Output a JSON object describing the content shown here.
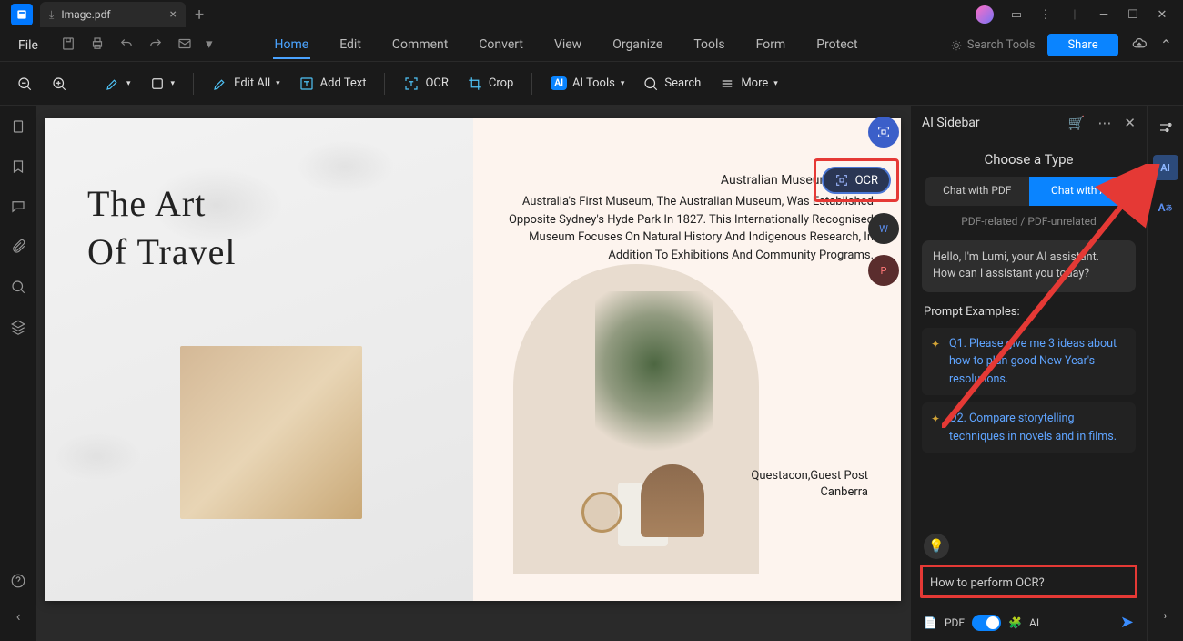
{
  "titlebar": {
    "tab_name": "Image.pdf"
  },
  "menubar": {
    "file": "File",
    "tabs": [
      "Home",
      "Edit",
      "Comment",
      "Convert",
      "View",
      "Organize",
      "Tools",
      "Form",
      "Protect"
    ],
    "active_tab": "Home",
    "search_tools": "Search Tools",
    "share": "Share"
  },
  "toolbar": {
    "edit_all": "Edit All",
    "add_text": "Add Text",
    "ocr": "OCR",
    "crop": "Crop",
    "ai_tools": "AI Tools",
    "search": "Search",
    "more": "More"
  },
  "document": {
    "art_line1": "The Art",
    "art_line2": "Of Travel",
    "museum_title": "Australian Museum,Sydney",
    "museum_body": "Australia's First Museum, The Australian Museum, Was Established Opposite Sydney's Hyde Park In 1827. This Internationally Recognised Museum Focuses On Natural History And Indigenous Research, In Addition To Exhibitions And Community Programs.",
    "q_line1": "Questacon,Guest Post",
    "q_line2": "Canberra",
    "ocr_bubble": "OCR"
  },
  "ai_sidebar": {
    "title": "AI Sidebar",
    "choose": "Choose a Type",
    "seg_pdf": "Chat with PDF",
    "seg_ai": "Chat with AI",
    "sub": "PDF-related / PDF-unrelated",
    "greeting": "Hello, I'm Lumi, your AI assistant. How can I assistant you today?",
    "examples_head": "Prompt Examples:",
    "ex1": "Q1. Please give me 3 ideas about how to plan good New Year's resolutions.",
    "ex2": "Q2. Compare storytelling techniques in novels and in films.",
    "input_value": "How to perform OCR?",
    "footer_pdf": "PDF",
    "footer_ai": "AI"
  },
  "right_rail": {
    "ai": "AI"
  }
}
